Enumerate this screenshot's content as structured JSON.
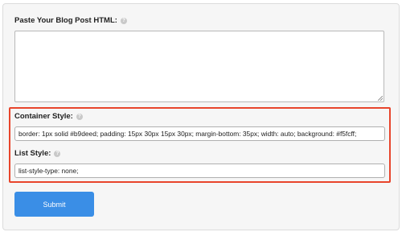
{
  "form": {
    "blog_html": {
      "label": "Paste Your Blog Post HTML:",
      "value": ""
    },
    "container_style": {
      "label": "Container Style:",
      "value": "border: 1px solid #b9deed; padding: 15px 30px 15px 30px; margin-bottom: 35px; width: auto; background: #f5fcff;"
    },
    "list_style": {
      "label": "List Style:",
      "value": "list-style-type: none;"
    },
    "submit_label": "Submit"
  },
  "help_icon_glyph": "?",
  "colors": {
    "accent": "#3a8ee6",
    "highlight": "#e8452c",
    "panel_bg": "#f6f6f6"
  }
}
